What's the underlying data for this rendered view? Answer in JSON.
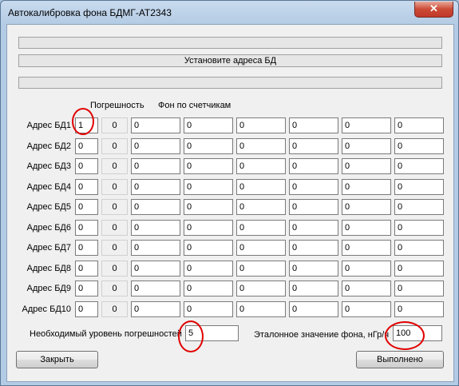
{
  "window": {
    "title": "Автокалибровка фона БДМГ-АТ2343",
    "close_glyph": "✕"
  },
  "status": {
    "message": "Установите адреса БД"
  },
  "headers": {
    "error": "Погрешность",
    "background": "Фон по счетчикам"
  },
  "rows": [
    {
      "label": "Адрес БД1",
      "address": "1",
      "error": "0",
      "counters": [
        "0",
        "0",
        "0",
        "0",
        "0",
        "0"
      ]
    },
    {
      "label": "Адрес БД2",
      "address": "0",
      "error": "0",
      "counters": [
        "0",
        "0",
        "0",
        "0",
        "0",
        "0"
      ]
    },
    {
      "label": "Адрес БД3",
      "address": "0",
      "error": "0",
      "counters": [
        "0",
        "0",
        "0",
        "0",
        "0",
        "0"
      ]
    },
    {
      "label": "Адрес БД4",
      "address": "0",
      "error": "0",
      "counters": [
        "0",
        "0",
        "0",
        "0",
        "0",
        "0"
      ]
    },
    {
      "label": "Адрес БД5",
      "address": "0",
      "error": "0",
      "counters": [
        "0",
        "0",
        "0",
        "0",
        "0",
        "0"
      ]
    },
    {
      "label": "Адрес БД6",
      "address": "0",
      "error": "0",
      "counters": [
        "0",
        "0",
        "0",
        "0",
        "0",
        "0"
      ]
    },
    {
      "label": "Адрес БД7",
      "address": "0",
      "error": "0",
      "counters": [
        "0",
        "0",
        "0",
        "0",
        "0",
        "0"
      ]
    },
    {
      "label": "Адрес БД8",
      "address": "0",
      "error": "0",
      "counters": [
        "0",
        "0",
        "0",
        "0",
        "0",
        "0"
      ]
    },
    {
      "label": "Адрес БД9",
      "address": "0",
      "error": "0",
      "counters": [
        "0",
        "0",
        "0",
        "0",
        "0",
        "0"
      ]
    },
    {
      "label": "Адрес БД10",
      "address": "0",
      "error": "0",
      "counters": [
        "0",
        "0",
        "0",
        "0",
        "0",
        "0"
      ]
    }
  ],
  "settings": {
    "error_level_label": "Необходимый уровень погрешностей",
    "error_level_value": "5",
    "reference_label": "Эталонное значение фона, нГр/ч",
    "reference_value": "100"
  },
  "buttons": {
    "close": "Закрыть",
    "run": "Выполнено"
  },
  "colors": {
    "annotation": "#e00000",
    "close_button": "#c0392b"
  }
}
